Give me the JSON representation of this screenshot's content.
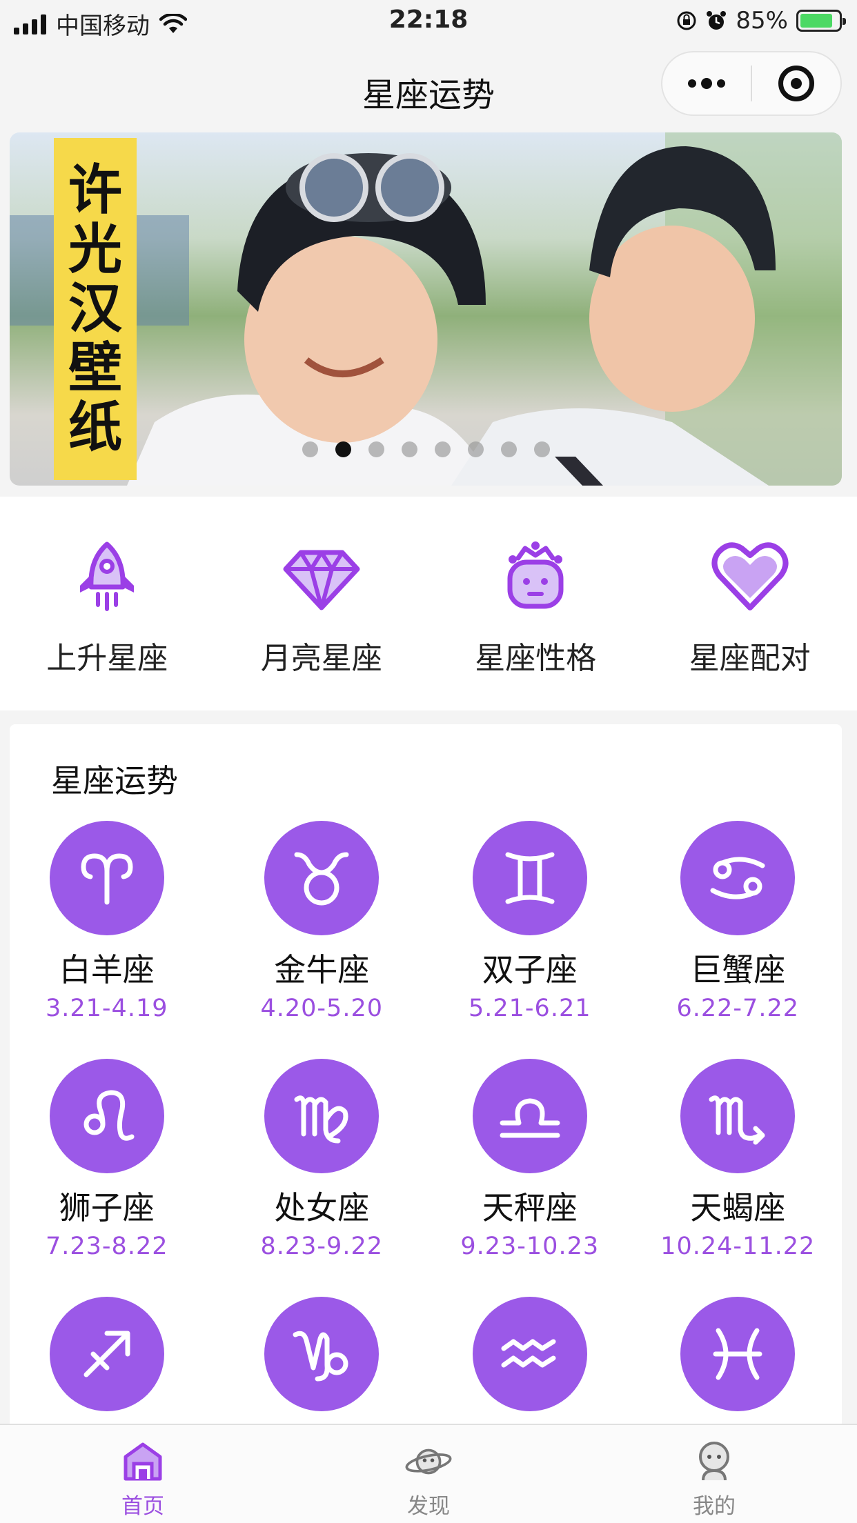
{
  "status_bar": {
    "carrier": "中国移动",
    "time": "22:18",
    "battery": "85%",
    "battery_level": 0.85
  },
  "nav": {
    "title": "星座运势",
    "more_icon": "more-dots-icon",
    "close_icon": "target-close-icon"
  },
  "banner": {
    "tag_chars": [
      "许",
      "光",
      "汉",
      "壁",
      "纸"
    ],
    "slide_count": 8,
    "active_slide": 2
  },
  "quick_entries": [
    {
      "label": "上升星座",
      "icon": "rocket-icon"
    },
    {
      "label": "月亮星座",
      "icon": "diamond-icon"
    },
    {
      "label": "星座性格",
      "icon": "face-crown-icon"
    },
    {
      "label": "星座配对",
      "icon": "heart-icon"
    }
  ],
  "zodiac": {
    "heading": "星座运势",
    "items": [
      {
        "name": "白羊座",
        "date": "3.21-4.19",
        "symbol": "♈"
      },
      {
        "name": "金牛座",
        "date": "4.20-5.20",
        "symbol": "♉"
      },
      {
        "name": "双子座",
        "date": "5.21-6.21",
        "symbol": "♊"
      },
      {
        "name": "巨蟹座",
        "date": "6.22-7.22",
        "symbol": "♋"
      },
      {
        "name": "狮子座",
        "date": "7.23-8.22",
        "symbol": "♌"
      },
      {
        "name": "处女座",
        "date": "8.23-9.22",
        "symbol": "♍"
      },
      {
        "name": "天秤座",
        "date": "9.23-10.23",
        "symbol": "♎"
      },
      {
        "name": "天蝎座",
        "date": "10.24-11.22",
        "symbol": "♏"
      },
      {
        "name": "",
        "date": "",
        "symbol": "♐"
      },
      {
        "name": "",
        "date": "",
        "symbol": "♑"
      },
      {
        "name": "",
        "date": "",
        "symbol": "♒"
      },
      {
        "name": "",
        "date": "",
        "symbol": "♓"
      }
    ]
  },
  "tabs": [
    {
      "label": "首页",
      "icon": "home-icon",
      "active": true
    },
    {
      "label": "发现",
      "icon": "planet-icon",
      "active": false
    },
    {
      "label": "我的",
      "icon": "profile-icon",
      "active": false
    }
  ],
  "colors": {
    "accent": "#9b59e8",
    "accent_text": "#9b4fe0",
    "banner_tag": "#f6d94a"
  }
}
